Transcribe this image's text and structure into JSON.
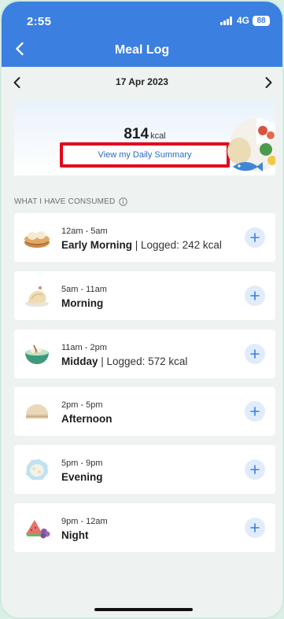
{
  "status": {
    "time": "2:55",
    "network": "4G",
    "battery": "88"
  },
  "header": {
    "title": "Meal Log"
  },
  "date": {
    "label": "17 Apr 2023"
  },
  "summary": {
    "kcal_value": "814",
    "kcal_unit": "kcal",
    "link": "View my Daily Summary"
  },
  "section": {
    "title": "WHAT I HAVE CONSUMED"
  },
  "meals": [
    {
      "time": "12am - 5am",
      "name": "Early Morning",
      "logged": " | Logged: 242 kcal",
      "icon": "dim-sum-icon"
    },
    {
      "time": "5am - 11am",
      "name": "Morning",
      "logged": "",
      "icon": "bread-icon"
    },
    {
      "time": "11am - 2pm",
      "name": "Midday",
      "logged": " | Logged: 572 kcal",
      "icon": "salad-bowl-icon"
    },
    {
      "time": "2pm - 5pm",
      "name": "Afternoon",
      "logged": "",
      "icon": "cake-icon"
    },
    {
      "time": "5pm - 9pm",
      "name": "Evening",
      "logged": "",
      "icon": "rice-plate-icon"
    },
    {
      "time": "9pm - 12am",
      "name": "Night",
      "logged": "",
      "icon": "fruit-icon"
    }
  ],
  "colors": {
    "primary": "#3b7fe0",
    "highlight": "#e3001b",
    "link": "#2d67c8"
  }
}
